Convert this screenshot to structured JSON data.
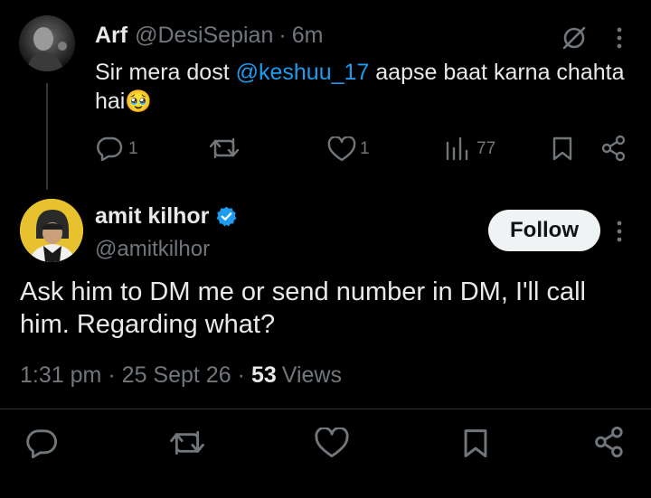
{
  "reply": {
    "display_name": "Arf",
    "handle": "@DesiSepian",
    "separator": "·",
    "time": "6m",
    "text_before": "Sir mera dost ",
    "mention": "@keshuu_17",
    "text_after": " aapse baat karna chahta hai",
    "emoji": "🥹",
    "actions": {
      "replies": "1",
      "likes": "1",
      "views": "77"
    }
  },
  "main_tweet": {
    "display_name": "amit kilhor",
    "handle": "@amitkilhor",
    "follow_label": "Follow",
    "text": "Ask him to DM me or send number in DM, I'll call him. Regarding what?",
    "time": "1:31 pm",
    "dot": "·",
    "date": "25 Sept 26",
    "views_count": "53",
    "views_label": "Views"
  },
  "colors": {
    "background": "#000000",
    "text": "#e7e9ea",
    "muted": "#71767b",
    "accent": "#1d9bf0",
    "verified": "#1d9bf0",
    "follow_bg": "#eff3f4"
  },
  "icons": [
    "reply-icon",
    "retweet-icon",
    "like-icon",
    "views-icon",
    "bookmark-icon",
    "share-icon",
    "grok-icon",
    "more-icon",
    "verified-badge-icon"
  ]
}
